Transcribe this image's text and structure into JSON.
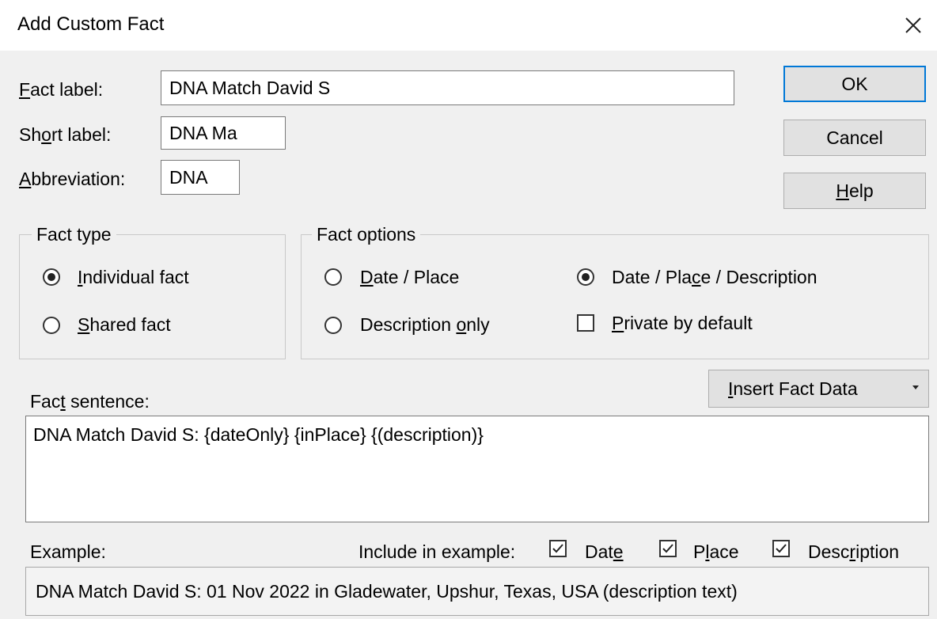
{
  "dialog": {
    "title": "Add Custom Fact",
    "close_icon": "close-icon"
  },
  "fields": {
    "fact_label": {
      "label_pre": "",
      "label_key": "F",
      "label_post": "act label:",
      "value": "DNA Match David S"
    },
    "short_label": {
      "label_pre": "Sh",
      "label_key": "o",
      "label_post": "rt label:",
      "value": "DNA Ma"
    },
    "abbreviation": {
      "label_pre": "",
      "label_key": "A",
      "label_post": "bbreviation:",
      "value": "DNA"
    }
  },
  "buttons": {
    "ok": "OK",
    "cancel": "Cancel",
    "help_key": "H",
    "help_post": "elp"
  },
  "fact_type": {
    "legend": "Fact type",
    "individual": {
      "key": "I",
      "post": "ndividual fact",
      "selected": true
    },
    "shared": {
      "key": "S",
      "post": "hared fact",
      "selected": false
    }
  },
  "fact_options": {
    "legend": "Fact options",
    "date_place": {
      "key": "D",
      "post": "ate / Place",
      "selected": false
    },
    "description_only": {
      "pre": "Description ",
      "key": "o",
      "post": "nly",
      "selected": false
    },
    "date_place_description": {
      "pre": "Date / Pla",
      "key": "c",
      "post": "e / Description",
      "selected": true
    },
    "private_by_default": {
      "key": "P",
      "post": "rivate by default",
      "checked": false
    }
  },
  "insert_fact_data": {
    "pre": "",
    "key": "I",
    "post": "nsert Fact Data",
    "arrow_icon": "dropdown-arrow-icon"
  },
  "fact_sentence": {
    "label_pre": "Fac",
    "label_key": "t",
    "label_post": " sentence:",
    "value": "DNA Match David S: {dateOnly} {inPlace} {(description)}"
  },
  "example": {
    "label": "Example:",
    "include_label": "Include in example:",
    "date": {
      "pre": "Dat",
      "key": "e",
      "post": "",
      "checked": true
    },
    "place": {
      "pre": "P",
      "key": "l",
      "post": "ace",
      "checked": true
    },
    "description": {
      "pre": "Desc",
      "key": "r",
      "post": "iption",
      "checked": true
    },
    "text": "DNA Match David S: 01 Nov 2022 in Gladewater, Upshur, Texas, USA (description text)"
  }
}
